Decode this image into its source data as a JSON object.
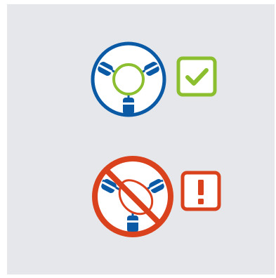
{
  "colors": {
    "panel_background": "#e6e7ea",
    "ring_blue": "#0a5aa6",
    "ring_inner": "#ffffff",
    "good_green": "#8bbf2f",
    "bad_red": "#d9421c"
  },
  "items": [
    {
      "status": "correct",
      "diagram_icon": "centered-ring-in-clamp-icon",
      "badge_icon": "checkmark-icon"
    },
    {
      "status": "incorrect",
      "diagram_icon": "deformed-ring-in-clamp-icon",
      "badge_icon": "exclamation-icon",
      "prohibited_icon": "no-entry-icon"
    }
  ]
}
